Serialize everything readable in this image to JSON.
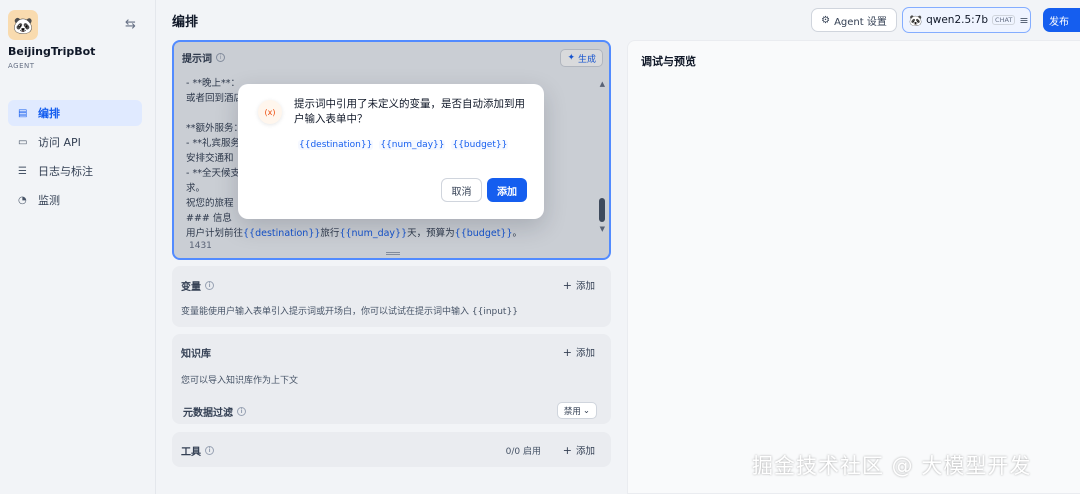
{
  "app": {
    "name": "BeijingTripBot",
    "type": "AGENT"
  },
  "sidebar": {
    "items": [
      {
        "label": "编排",
        "icon": "layout-icon",
        "active": true
      },
      {
        "label": "访问 API",
        "icon": "terminal-icon",
        "active": false
      },
      {
        "label": "日志与标注",
        "icon": "file-icon",
        "active": false
      },
      {
        "label": "监测",
        "icon": "gauge-icon",
        "active": false
      }
    ]
  },
  "header": {
    "title": "编排",
    "agent_settings_label": "Agent 设置",
    "model_name": "qwen2.5:7b",
    "model_mode": "CHAT",
    "publish_label": "发布"
  },
  "prompt": {
    "label": "提示词",
    "generate_label": "生成",
    "lines": [
      "- **晚上**：",
      "或者回到酒店",
      "",
      "**额外服务：",
      "- **礼宾服务",
      "安排交通和",
      "- **全天候支",
      "求。",
      "祝您的旅程",
      "### 信息"
    ],
    "last_line_parts": [
      "用户计划前往",
      "{{destination}}",
      "旅行",
      "{{num_day}}",
      "天，预算为",
      "{{budget}}",
      "。"
    ],
    "char_count": "1431"
  },
  "modal": {
    "icon_text": "(x)",
    "message": "提示词中引用了未定义的变量，是否自动添加到用户输入表单中？",
    "variables": [
      "{{destination}}",
      "{{num_day}}",
      "{{budget}}"
    ],
    "cancel_label": "取消",
    "confirm_label": "添加"
  },
  "variables_section": {
    "title": "变量",
    "add_label": "添加",
    "description": "变量能使用户输入表单引入提示词或开场白，你可以试试在提示词中输入 {{input}}"
  },
  "knowledge_section": {
    "title": "知识库",
    "add_label": "添加",
    "description": "您可以导入知识库作为上下文",
    "metadata_filter_label": "元数据过滤",
    "metadata_filter_value": "禁用"
  },
  "tools_section": {
    "title": "工具",
    "count": "0/0 启用",
    "add_label": "添加"
  },
  "debug_panel": {
    "title": "调试与预览"
  },
  "watermark": "掘金技术社区 @ 大模型开发",
  "colors": {
    "accent": "#155eef",
    "background": "#f2f4f7"
  }
}
